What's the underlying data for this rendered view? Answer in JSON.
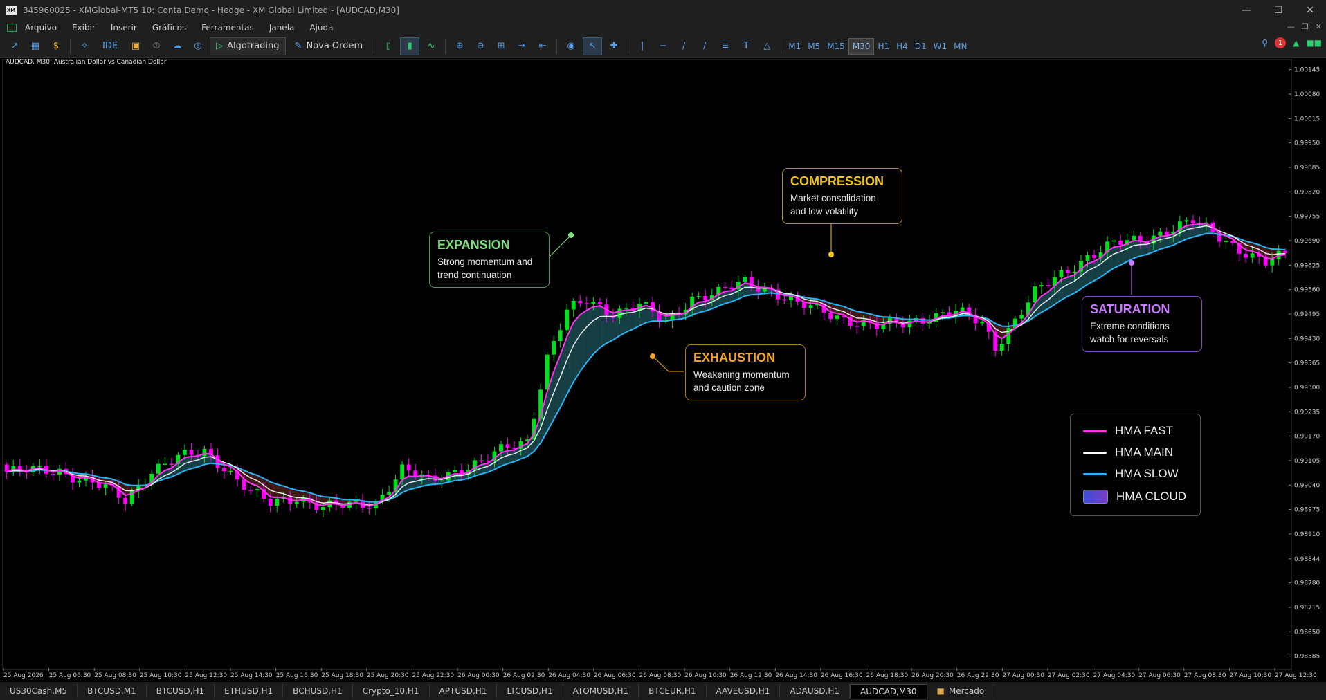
{
  "window": {
    "logo": "XM",
    "title": "345960025 - XMGlobal-MT5 10: Conta Demo - Hedge - XM Global Limited - [AUDCAD,M30]",
    "controls": [
      "minimize-icon",
      "maximize-icon",
      "close-icon"
    ]
  },
  "menu": {
    "items": [
      "Arquivo",
      "Exibir",
      "Inserir",
      "Gráficos",
      "Ferramentas",
      "Janela",
      "Ajuda"
    ]
  },
  "toolbar": {
    "ide_label": "IDE",
    "algotrading_label": "Algotrading",
    "new_order_label": "Nova Ordem",
    "notification_count": "1",
    "timeframes": [
      "M1",
      "M5",
      "M15",
      "M30",
      "H1",
      "H4",
      "D1",
      "W1",
      "MN"
    ],
    "active_timeframe": "M30"
  },
  "chart": {
    "info": "AUDCAD, M30:  Australian Dollar vs Canadian Dollar",
    "colors": {
      "bull": "#00e11e",
      "bear": "#ff00ff",
      "hma_fast": "#ff33ee",
      "hma_main": "#ffffff",
      "hma_slow": "#29b6f6",
      "cloud_bull": "#1a4a52",
      "cloud_bear": "#4a1f1c"
    }
  },
  "chart_data": {
    "type": "candlestick",
    "symbol": "AUDCAD",
    "timeframe": "M30",
    "ylim": [
      0.98553,
      1.00172
    ],
    "y_ticks": [
      "1.00145",
      "1.00080",
      "1.00015",
      "0.99950",
      "0.99885",
      "0.99820",
      "0.99755",
      "0.99690",
      "0.99625",
      "0.99560",
      "0.99495",
      "0.99430",
      "0.99365",
      "0.99300",
      "0.99235",
      "0.99170",
      "0.99105",
      "0.99040",
      "0.98975",
      "0.98910",
      "0.98844",
      "0.98780",
      "0.98715",
      "0.98650",
      "0.98585"
    ],
    "x_ticks": [
      "25 Aug 2026",
      "25 Aug 06:30",
      "25 Aug 08:30",
      "25 Aug 10:30",
      "25 Aug 12:30",
      "25 Aug 14:30",
      "25 Aug 16:30",
      "25 Aug 18:30",
      "25 Aug 20:30",
      "25 Aug 22:30",
      "26 Aug 00:30",
      "26 Aug 02:30",
      "26 Aug 04:30",
      "26 Aug 06:30",
      "26 Aug 08:30",
      "26 Aug 10:30",
      "26 Aug 12:30",
      "26 Aug 14:30",
      "26 Aug 16:30",
      "26 Aug 18:30",
      "26 Aug 20:30",
      "26 Aug 22:30",
      "27 Aug 00:30",
      "27 Aug 02:30",
      "27 Aug 04:30",
      "27 Aug 06:30",
      "27 Aug 08:30",
      "27 Aug 10:30",
      "27 Aug 12:30"
    ],
    "close_anchors": [
      [
        0,
        0.99075
      ],
      [
        8,
        0.9908
      ],
      [
        12,
        0.9905
      ],
      [
        15,
        0.9903
      ],
      [
        18,
        0.99
      ],
      [
        22,
        0.9908
      ],
      [
        26,
        0.9911
      ],
      [
        30,
        0.9913
      ],
      [
        33,
        0.9909
      ],
      [
        37,
        0.9902
      ],
      [
        40,
        0.9899
      ],
      [
        44,
        0.9901
      ],
      [
        48,
        0.9898
      ],
      [
        52,
        0.98985
      ],
      [
        56,
        0.98995
      ],
      [
        60,
        0.9908
      ],
      [
        64,
        0.9905
      ],
      [
        68,
        0.9908
      ],
      [
        72,
        0.991
      ],
      [
        76,
        0.9914
      ],
      [
        79,
        0.9916
      ],
      [
        82,
        0.9938
      ],
      [
        85,
        0.995
      ],
      [
        88,
        0.9953
      ],
      [
        92,
        0.995
      ],
      [
        96,
        0.9952
      ],
      [
        100,
        0.9947
      ],
      [
        104,
        0.9954
      ],
      [
        108,
        0.9955
      ],
      [
        112,
        0.9958
      ],
      [
        116,
        0.9956
      ],
      [
        120,
        0.9952
      ],
      [
        124,
        0.995
      ],
      [
        128,
        0.9948
      ],
      [
        132,
        0.9946
      ],
      [
        136,
        0.9947
      ],
      [
        140,
        0.9949
      ],
      [
        144,
        0.995
      ],
      [
        148,
        0.9947
      ],
      [
        150,
        0.9941
      ],
      [
        153,
        0.9948
      ],
      [
        156,
        0.9955
      ],
      [
        160,
        0.996
      ],
      [
        164,
        0.9965
      ],
      [
        168,
        0.9968
      ],
      [
        172,
        0.9969
      ],
      [
        176,
        0.9972
      ],
      [
        180,
        0.9974
      ],
      [
        184,
        0.997
      ],
      [
        188,
        0.9966
      ],
      [
        191,
        0.9963
      ],
      [
        194,
        0.9965
      ]
    ],
    "series": [
      {
        "name": "HMA FAST",
        "color": "#ff33ee"
      },
      {
        "name": "HMA MAIN",
        "color": "#ffffff"
      },
      {
        "name": "HMA SLOW",
        "color": "#29b6f6"
      },
      {
        "name": "HMA CLOUD",
        "color": "#5a3fd0"
      }
    ],
    "legend_position": "right"
  },
  "annotations": {
    "expansion": {
      "title": "EXPANSION",
      "text": "Strong momentum and trend continuation",
      "color": "#7de07d"
    },
    "compression": {
      "title": "COMPRESSION",
      "text": "Market consolidation and low volatility",
      "color": "#f0c419"
    },
    "exhaustion": {
      "title": "EXHAUSTION",
      "text": "Weakening momentum and caution zone",
      "color": "#f5a623"
    },
    "saturation": {
      "title": "SATURATION",
      "text": "Extreme conditions watch for reversals",
      "color": "#c879ff"
    }
  },
  "legend": {
    "items": [
      {
        "label": "HMA FAST",
        "color": "#ff33ee"
      },
      {
        "label": "HMA MAIN",
        "color": "#ffffff"
      },
      {
        "label": "HMA SLOW",
        "color": "#29b6f6"
      },
      {
        "label": "HMA CLOUD",
        "color": "#5a3fd0"
      }
    ]
  },
  "tabs": {
    "items": [
      "US30Cash,M5",
      "BTCUSD,M1",
      "BTCUSD,H1",
      "ETHUSD,H1",
      "BCHUSD,H1",
      "Crypto_10,H1",
      "APTUSD,H1",
      "LTCUSD,H1",
      "ATOMUSD,H1",
      "BTCEUR,H1",
      "AAVEUSD,H1",
      "ADAUSD,H1",
      "AUDCAD,M30"
    ],
    "active": "AUDCAD,M30",
    "market_label": "Mercado"
  }
}
